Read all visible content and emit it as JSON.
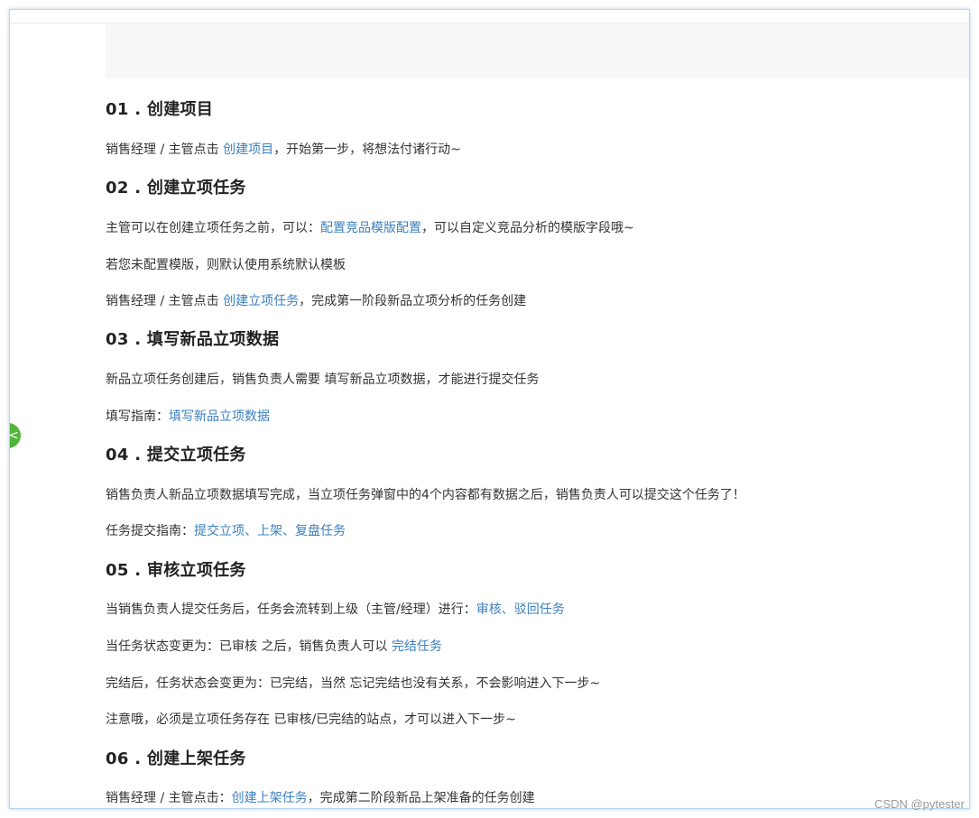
{
  "s1": {
    "title": "01 . 创建项目",
    "p1": {
      "pre": "销售经理 / 主管点击 ",
      "link": "创建项目",
      "post": "，开始第一步，将想法付诸行动~"
    }
  },
  "s2": {
    "title": "02 . 创建立项任务",
    "p1": {
      "pre": "主管可以在创建立项任务之前，可以：",
      "link": "配置竞品模版配置",
      "post": "，可以自定义竞品分析的模版字段哦~"
    },
    "p2": "若您未配置模版，则默认使用系统默认模板",
    "p3": {
      "pre": "销售经理 / 主管点击 ",
      "link": "创建立项任务",
      "post": "，完成第一阶段新品立项分析的任务创建"
    }
  },
  "s3": {
    "title": "03 . 填写新品立项数据",
    "p1": "新品立项任务创建后，销售负责人需要 填写新品立项数据，才能进行提交任务",
    "p2": {
      "pre": "填写指南：",
      "link": "填写新品立项数据",
      "post": ""
    }
  },
  "s4": {
    "title": "04 . 提交立项任务",
    "p1": "销售负责人新品立项数据填写完成，当立项任务弹窗中的4个内容都有数据之后，销售负责人可以提交这个任务了！",
    "p2": {
      "pre": "任务提交指南：",
      "link": "提交立项、上架、复盘任务",
      "post": ""
    }
  },
  "s5": {
    "title": "05 . 审核立项任务",
    "p1": {
      "pre": "当销售负责人提交任务后，任务会流转到上级（主管/经理）进行：",
      "link": "审核、驳回任务",
      "post": ""
    },
    "p2": {
      "pre": "当任务状态变更为：已审核 之后，销售负责人可以 ",
      "link": "完结任务",
      "post": ""
    },
    "p3": "完结后，任务状态会变更为：已完结，当然 忘记完结也没有关系，不会影响进入下一步~",
    "p4": "注意哦，必须是立项任务存在 已审核/已完结的站点，才可以进入下一步~"
  },
  "s6": {
    "title": "06 . 创建上架任务",
    "p1": {
      "pre": "销售经理 / 主管点击：",
      "link": "创建上架任务",
      "post": "，完成第二阶段新品上架准备的任务创建"
    }
  },
  "sidebar_toggle_glyph": "<",
  "watermark": "CSDN @pytester",
  "colors": {
    "link": "#3a7fbf",
    "toggle": "#52b43a",
    "frame_border": "#b8d4ef"
  }
}
